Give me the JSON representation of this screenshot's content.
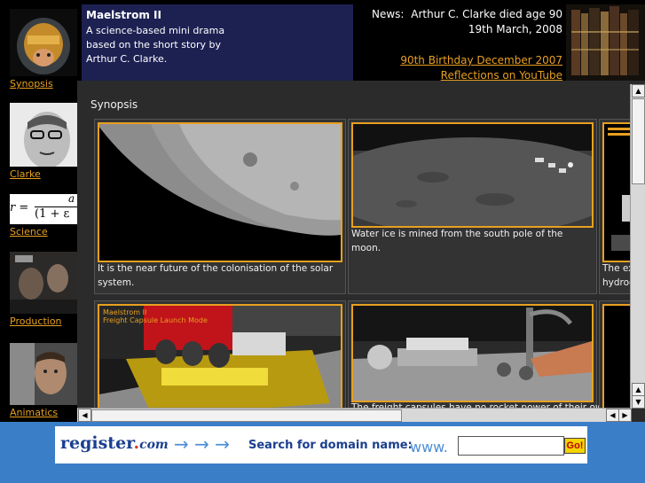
{
  "nav": {
    "items": [
      {
        "label": "Synopsis"
      },
      {
        "label": "Clarke"
      },
      {
        "label": "Science",
        "formula_lhs": "r =",
        "formula_num": "a",
        "formula_den": "(1 + ε"
      },
      {
        "label": "Production"
      },
      {
        "label": "Animatics"
      }
    ]
  },
  "header": {
    "title": "Maelstrom II",
    "description": "A science-based mini drama based on the short story by Arthur C. Clarke.",
    "news_label": "News:",
    "news_text": "Arthur C. Clarke died age 90",
    "news_date": "19th March, 2008",
    "link_birthday": "90th Birthday December 2007",
    "link_youtube": "Reflections on YouTube"
  },
  "content": {
    "section_title": "Synopsis",
    "panels": [
      {
        "caption": "It is the near future of the colonisation of the solar system."
      },
      {
        "caption": "Water ice is mined from the south pole of the moon."
      },
      {
        "caption": "The ext hydroge"
      },
      {
        "caption": "",
        "image_text_1": "Maelstrom II",
        "image_text_2": "Freight Capsule Launch Mode"
      },
      {
        "caption": "The freight capsules have no rocket power of their own"
      },
      {
        "caption": ""
      }
    ]
  },
  "scrollbars": {
    "up_arrow": "▲",
    "down_arrow": "▼",
    "left_arrow": "◀",
    "right_arrow": "▶"
  },
  "banner": {
    "logo_main": "register",
    "logo_dot": ".",
    "logo_com": "com",
    "arrows": "→ → →",
    "search_label": "Search for domain name:",
    "www": "www.",
    "input_value": "",
    "go_label": "Go!"
  },
  "colors": {
    "accent": "#e8a020",
    "header_bg": "#1d2152",
    "banner_bg": "#3a7ec8"
  }
}
